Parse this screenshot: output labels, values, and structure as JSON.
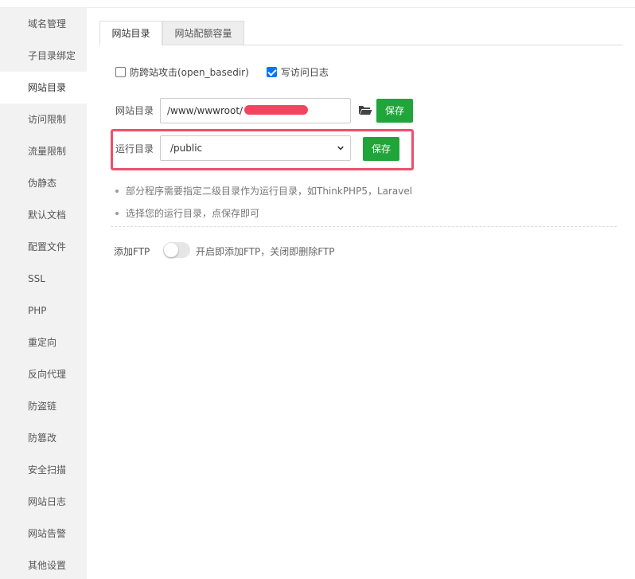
{
  "sidebar": {
    "items": [
      {
        "label": "域名管理"
      },
      {
        "label": "子目录绑定"
      },
      {
        "label": "网站目录"
      },
      {
        "label": "访问限制"
      },
      {
        "label": "流量限制"
      },
      {
        "label": "伪静态"
      },
      {
        "label": "默认文档"
      },
      {
        "label": "配置文件"
      },
      {
        "label": "SSL"
      },
      {
        "label": "PHP"
      },
      {
        "label": "重定向"
      },
      {
        "label": "反向代理"
      },
      {
        "label": "防盗链"
      },
      {
        "label": "防篡改"
      },
      {
        "label": "安全扫描"
      },
      {
        "label": "网站日志"
      },
      {
        "label": "网站告警"
      },
      {
        "label": "其他设置"
      }
    ],
    "active_label": "网站目录"
  },
  "tabs": [
    {
      "label": "网站目录",
      "active": true
    },
    {
      "label": "网站配额容量",
      "active": false
    }
  ],
  "options": {
    "anti_xss": {
      "label": "防跨站攻击(open_basedir)",
      "checked": false
    },
    "access_log": {
      "label": "写访问日志",
      "checked": true
    }
  },
  "site_dir": {
    "label": "网站目录",
    "value": "/www/wwwroot/",
    "save_label": "保存",
    "folder_icon": "folder-open-icon"
  },
  "run_dir": {
    "label": "运行目录",
    "selected": "/public",
    "save_label": "保存"
  },
  "tips": [
    "部分程序需要指定二级目录作为运行目录，如ThinkPHP5，Laravel",
    "选择您的运行目录，点保存即可"
  ],
  "ftp": {
    "label": "添加FTP",
    "enabled": false,
    "description": "开启即添加FTP，关闭即删除FTP"
  },
  "colors": {
    "save_button": "#20a53a",
    "highlight_border": "#ef4f6d",
    "checkbox_checked": "#0075ff"
  }
}
